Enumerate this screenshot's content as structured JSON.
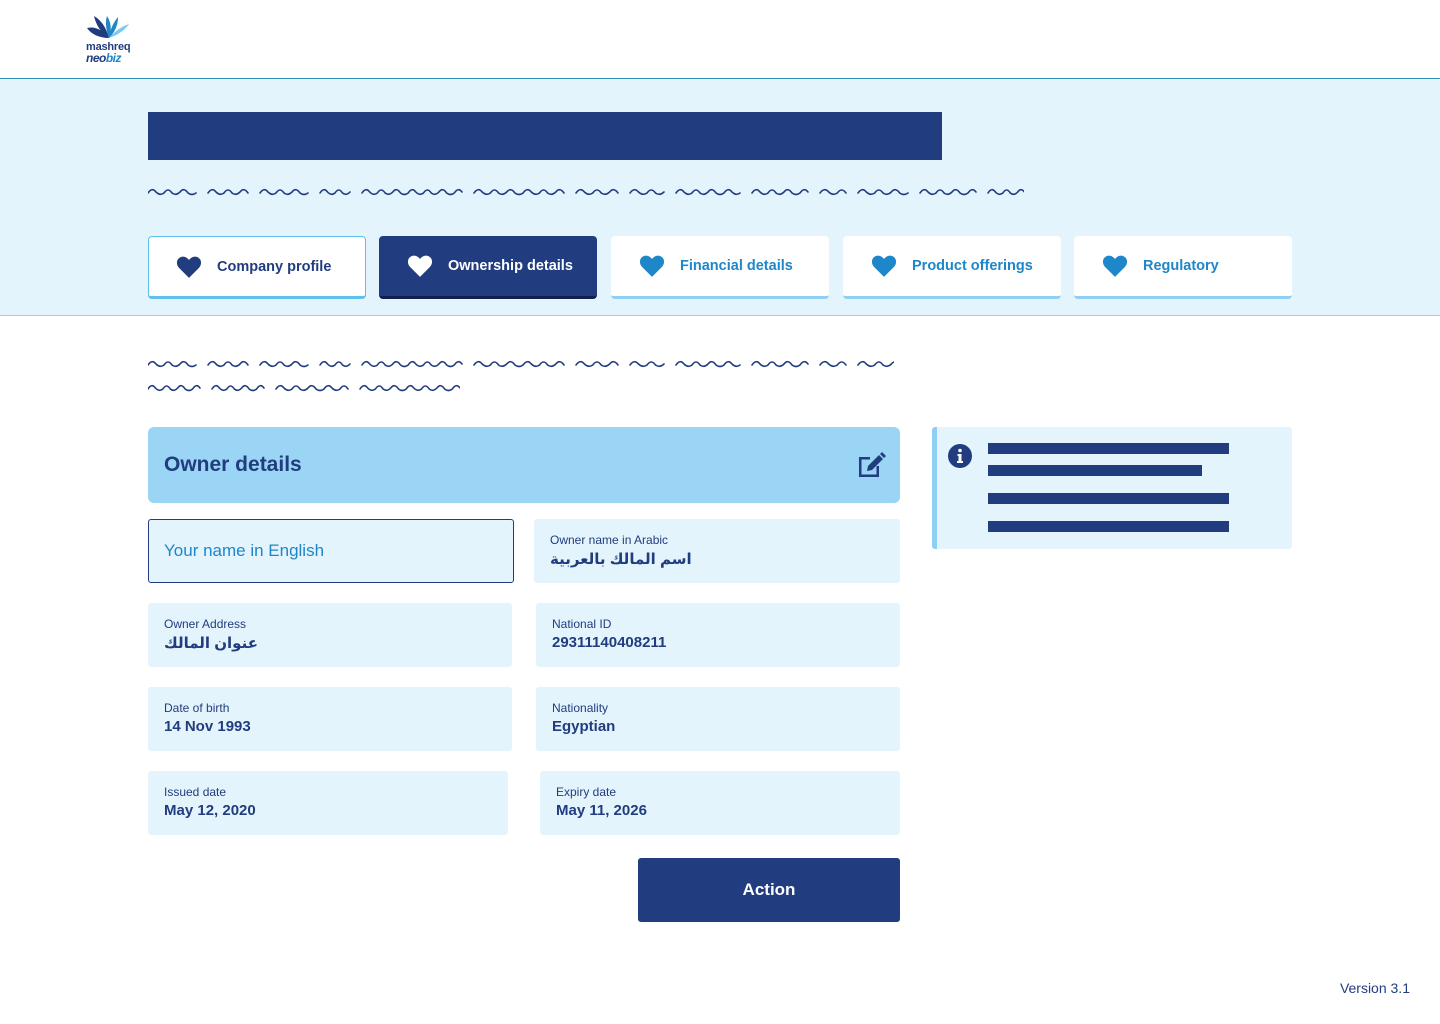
{
  "brand": {
    "line1": "mashreq",
    "line2_a": "neo",
    "line2_b": "biz",
    "colors": {
      "primary": "#213c7f",
      "accent": "#1d87c9",
      "light": "#e3f4fc",
      "card": "#9ad5f5"
    }
  },
  "tabs": [
    {
      "label": "Company profile",
      "icon": "heart-icon",
      "state": "done"
    },
    {
      "label": "Ownership details",
      "icon": "heart-icon",
      "state": "active"
    },
    {
      "label": "Financial details",
      "icon": "heart-icon",
      "state": "todo"
    },
    {
      "label": "Product offerings",
      "icon": "heart-icon",
      "state": "todo"
    },
    {
      "label": "Regulatory",
      "icon": "heart-icon",
      "state": "todo"
    }
  ],
  "owner_card": {
    "title": "Owner details",
    "edit_icon": "edit-icon"
  },
  "fields": {
    "name_en": {
      "placeholder": "Your name in English",
      "value": ""
    },
    "name_ar": {
      "label": "Owner name in Arabic",
      "value": "اسم المالك بالعربية"
    },
    "address": {
      "label": "Owner Address",
      "value": "عنوان المالك"
    },
    "national_id": {
      "label": "National ID",
      "value": "29311140408211"
    },
    "dob": {
      "label": "Date of birth",
      "value": "14 Nov 1993"
    },
    "nationality": {
      "label": "Nationality",
      "value": "Egyptian"
    },
    "issued": {
      "label": "Issued date",
      "value": "May 12, 2020"
    },
    "expiry": {
      "label": "Expiry date",
      "value": "May 11, 2026"
    }
  },
  "action_label": "Action",
  "info_icon": "info-icon",
  "version": "Version 3.1"
}
